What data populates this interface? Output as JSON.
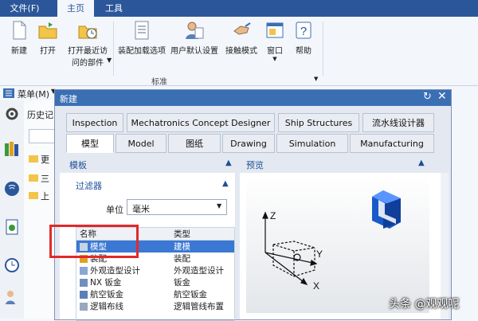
{
  "top_tabs": {
    "file": "文件(F)",
    "home": "主页",
    "tools": "工具"
  },
  "ribbon": {
    "buttons": [
      {
        "label": "新建"
      },
      {
        "label": "打开"
      },
      {
        "label_line1": "打开最近访",
        "label_line2": "问的部件"
      },
      {
        "label": "装配加载选项"
      },
      {
        "label": "用户默认设置"
      },
      {
        "label": "接触模式"
      },
      {
        "label": "窗口"
      },
      {
        "label": "帮助"
      }
    ],
    "group_label": "标准"
  },
  "menu_line": {
    "menu_label": "菜单(M)",
    "history_label": "历史记"
  },
  "behind_list": [
    "更",
    "三",
    "上"
  ],
  "dialog": {
    "title": "新建",
    "tabs_row1": [
      "Inspection",
      "Mechatronics Concept Designer",
      "Ship Structures",
      "流水线设计器"
    ],
    "tabs_row2": [
      "模型",
      "Model",
      "图纸",
      "Drawing",
      "Simulation",
      "Manufacturing"
    ],
    "selected_tab": "模型",
    "template_header": "模板",
    "preview_header": "预览",
    "filter_header": "过滤器",
    "unit_label": "单位",
    "unit_value": "毫米",
    "table": {
      "col_name": "名称",
      "col_type": "类型",
      "rows": [
        {
          "name": "模型",
          "type": "建模"
        },
        {
          "name": "装配",
          "type": "装配"
        },
        {
          "name": "外观造型设计",
          "type": "外观造型设计"
        },
        {
          "name": "NX 钣金",
          "type": "钣金"
        },
        {
          "name": "航空钣金",
          "type": "航空钣金"
        },
        {
          "name": "逻辑布线",
          "type": "逻辑管线布置"
        }
      ],
      "selected_row": 0
    },
    "axes": {
      "z": "Z",
      "y": "Y",
      "x": "X"
    }
  },
  "watermark": "头条 @观观呢",
  "colors": {
    "accent": "#2b579a",
    "selection": "#3a78d3",
    "highlight_box": "#e12a2a"
  }
}
